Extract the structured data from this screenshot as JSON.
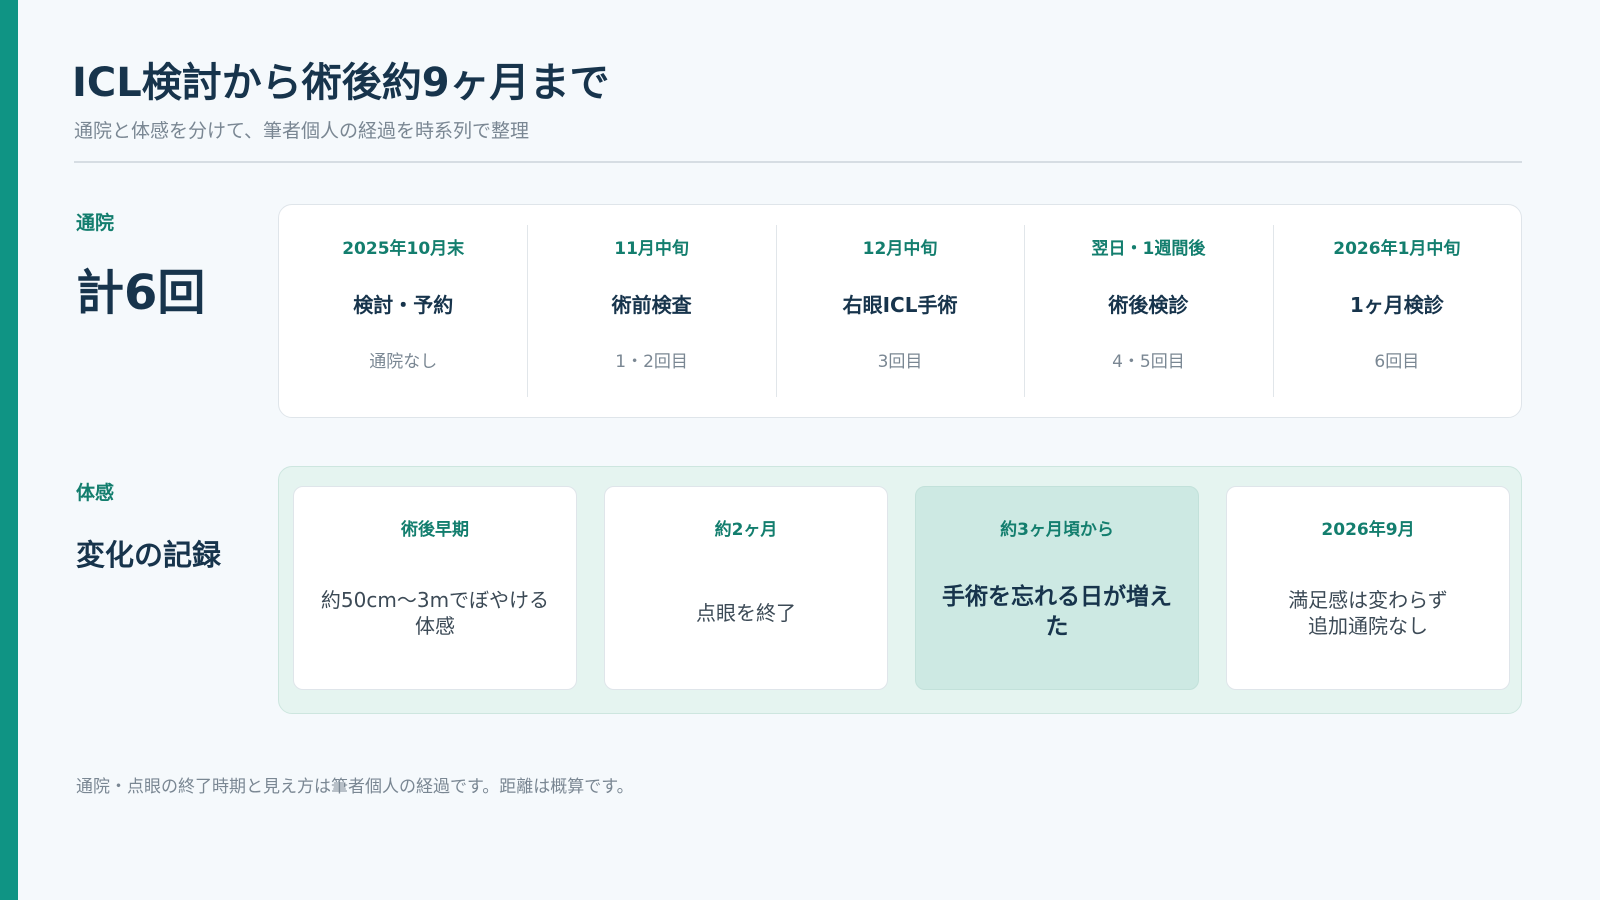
{
  "title": "ICL検討から術後約9ヶ月まで",
  "subtitle": "通院と体感を分けて、筆者個人の経過を時系列で整理",
  "visits": {
    "label": "通院",
    "total": "計6回",
    "items": [
      {
        "date": "2025年10月末",
        "event": "検討・予約",
        "count": "通院なし"
      },
      {
        "date": "11月中旬",
        "event": "術前検査",
        "count": "1・2回目"
      },
      {
        "date": "12月中旬",
        "event": "右眼ICL手術",
        "count": "3回目"
      },
      {
        "date": "翌日・1週間後",
        "event": "術後検診",
        "count": "4・5回目"
      },
      {
        "date": "2026年1月中旬",
        "event": "1ヶ月検診",
        "count": "6回目"
      }
    ]
  },
  "feelings": {
    "label": "体感",
    "heading": "変化の記録",
    "items": [
      {
        "period": "術後早期",
        "text": "約50cm〜3mでぼやける\n体感"
      },
      {
        "period": "約2ヶ月",
        "text": "点眼を終了"
      },
      {
        "period": "約3ヶ月頃から",
        "text": "手術を忘れる日が増え\nた"
      },
      {
        "period": "2026年9月",
        "text": "満足感は変わらず\n追加通院なし"
      }
    ]
  },
  "footnote": "通院・点眼の終了時期と見え方は筆者個人の経過です。距離は概算です。",
  "colors": {
    "accent": "#0f9484",
    "label_green": "#137e6e",
    "highlight_card": "#cde9e3",
    "feel_panel_bg": "#e5f4f0"
  }
}
